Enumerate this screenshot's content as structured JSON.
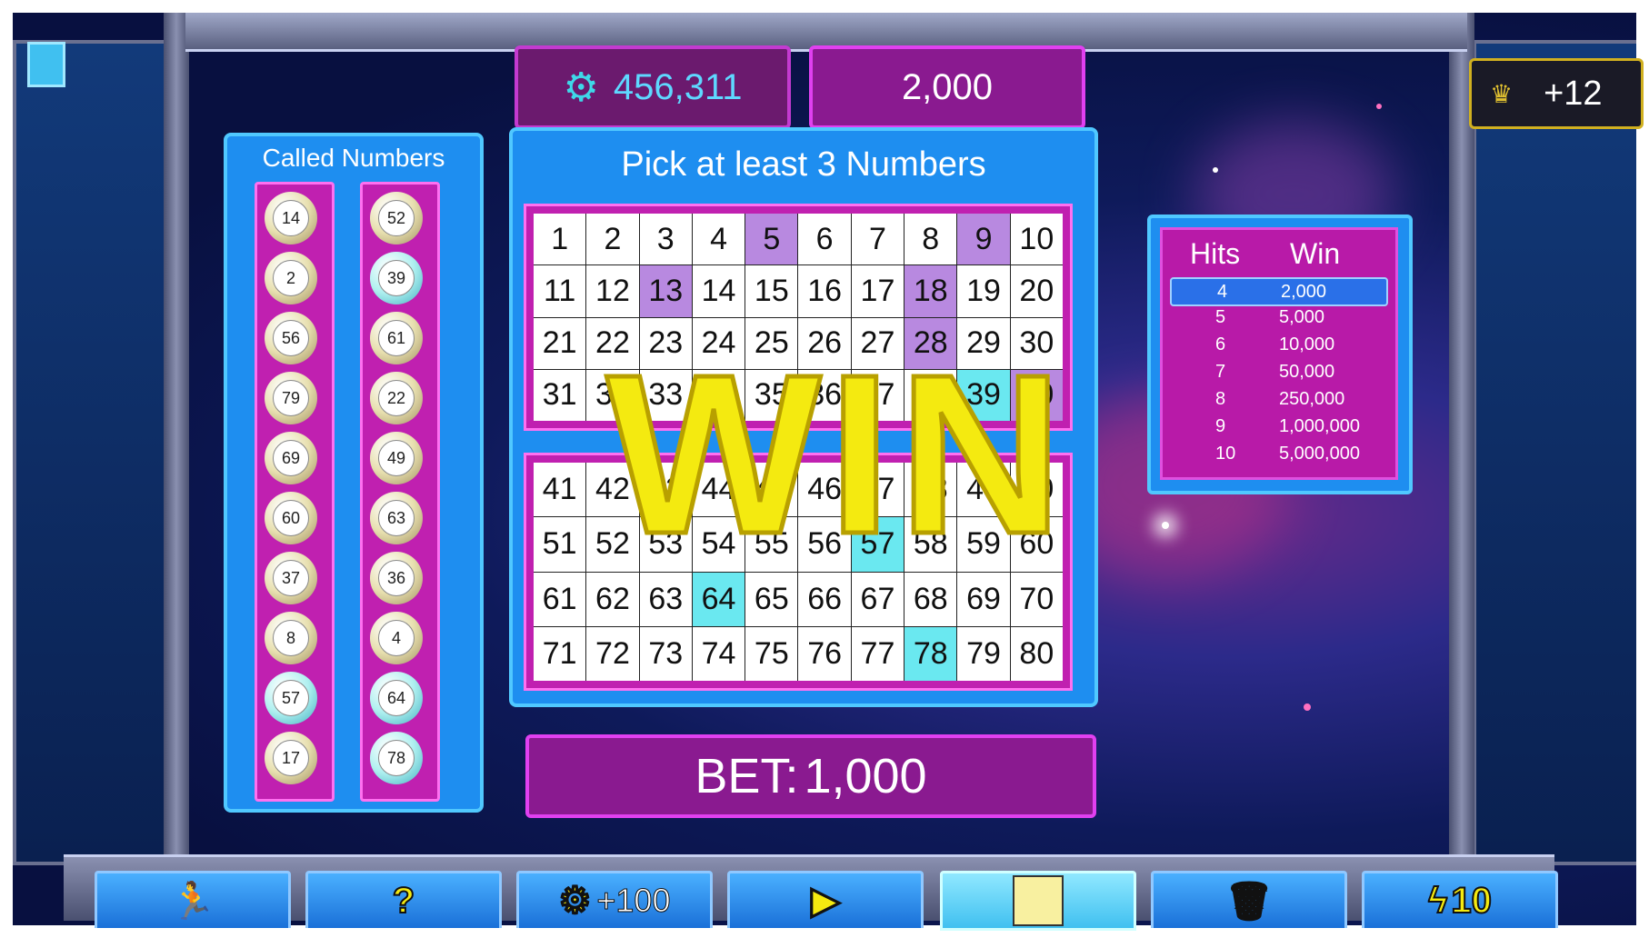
{
  "header": {
    "credits": "456,311",
    "last_win": "2,000",
    "level_bonus": "+12"
  },
  "called_panel": {
    "title": "Called Numbers",
    "left_column": [
      {
        "number": "14",
        "highlight": false
      },
      {
        "number": "2",
        "highlight": false
      },
      {
        "number": "56",
        "highlight": false
      },
      {
        "number": "79",
        "highlight": false
      },
      {
        "number": "69",
        "highlight": false
      },
      {
        "number": "60",
        "highlight": false
      },
      {
        "number": "37",
        "highlight": false
      },
      {
        "number": "8",
        "highlight": false
      },
      {
        "number": "57",
        "highlight": true
      },
      {
        "number": "17",
        "highlight": false
      }
    ],
    "right_column": [
      {
        "number": "52",
        "highlight": false
      },
      {
        "number": "39",
        "highlight": true
      },
      {
        "number": "61",
        "highlight": false
      },
      {
        "number": "22",
        "highlight": false
      },
      {
        "number": "49",
        "highlight": false
      },
      {
        "number": "63",
        "highlight": false
      },
      {
        "number": "36",
        "highlight": false
      },
      {
        "number": "4",
        "highlight": false
      },
      {
        "number": "64",
        "highlight": true
      },
      {
        "number": "78",
        "highlight": true
      }
    ]
  },
  "board": {
    "title": "Pick at least 3 Numbers",
    "picked": [
      5,
      9,
      13,
      18,
      28,
      40
    ],
    "hit": [
      39,
      57,
      64,
      78
    ],
    "win_banner": "WIN"
  },
  "bet": {
    "label": "BET:",
    "value": "1,000"
  },
  "paytable": {
    "headers": {
      "hits": "Hits",
      "win": "Win"
    },
    "rows": [
      {
        "hits": "4",
        "win": "2,000",
        "selected": true
      },
      {
        "hits": "5",
        "win": "5,000",
        "selected": false
      },
      {
        "hits": "6",
        "win": "10,000",
        "selected": false
      },
      {
        "hits": "7",
        "win": "50,000",
        "selected": false
      },
      {
        "hits": "8",
        "win": "250,000",
        "selected": false
      },
      {
        "hits": "9",
        "win": "1,000,000",
        "selected": false
      },
      {
        "hits": "10",
        "win": "5,000,000",
        "selected": false
      }
    ]
  },
  "toolbar": {
    "buy_label": "+100",
    "auto_label": "10"
  },
  "colors": {
    "picked": "#b889e0",
    "hit": "#6ae8f0",
    "win_text": "#f4ea10",
    "panel_blue": "#1e8ef0",
    "panel_magenta": "#c020b0"
  }
}
